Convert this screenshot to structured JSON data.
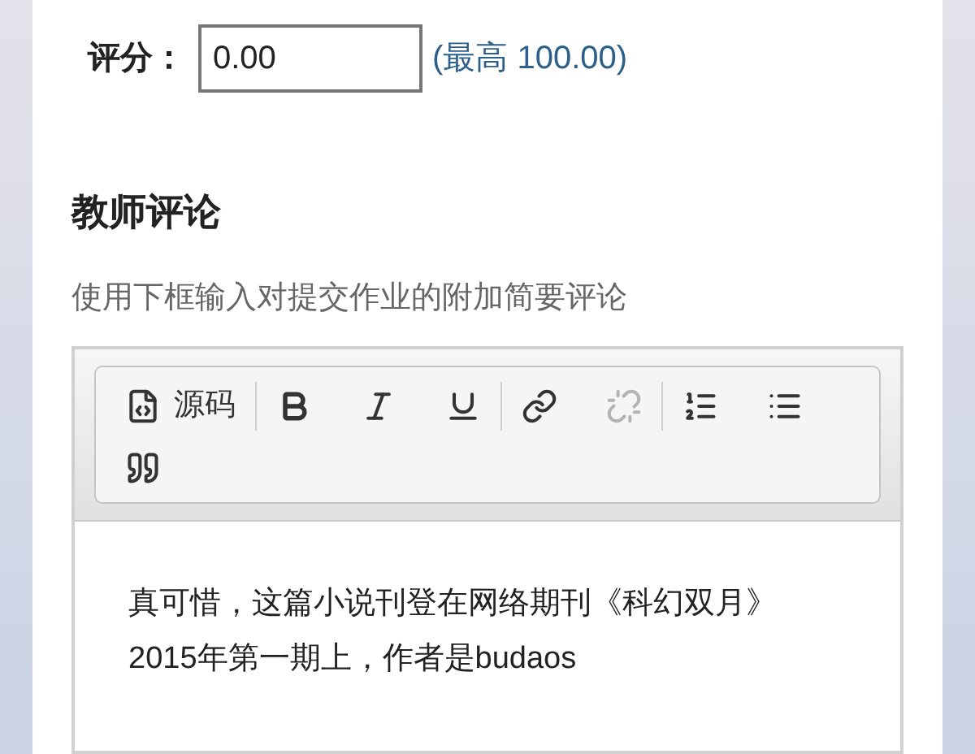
{
  "grade": {
    "label": "评分：",
    "value": "0.00",
    "max_note": "(最高 100.00)"
  },
  "feedback": {
    "title": "教师评论",
    "description": "使用下框输入对提交作业的附加简要评论",
    "toolbar": {
      "rows": [
        [
          [
            {
              "kind": "source",
              "label": "源码",
              "disabled": false
            }
          ],
          [
            {
              "kind": "bold",
              "disabled": false
            },
            {
              "kind": "italic",
              "disabled": false
            },
            {
              "kind": "underline",
              "disabled": false
            }
          ],
          [
            {
              "kind": "link",
              "disabled": false
            },
            {
              "kind": "unlink",
              "disabled": true
            }
          ],
          [
            {
              "kind": "numbered-list",
              "disabled": false
            },
            {
              "kind": "bulleted-list",
              "disabled": false
            }
          ]
        ],
        [
          [
            {
              "kind": "blockquote",
              "disabled": false
            }
          ]
        ]
      ]
    },
    "content": "真可惜，这篇小说刊登在网络期刊《科幻双月》2015年第一期上，作者是budaos"
  }
}
